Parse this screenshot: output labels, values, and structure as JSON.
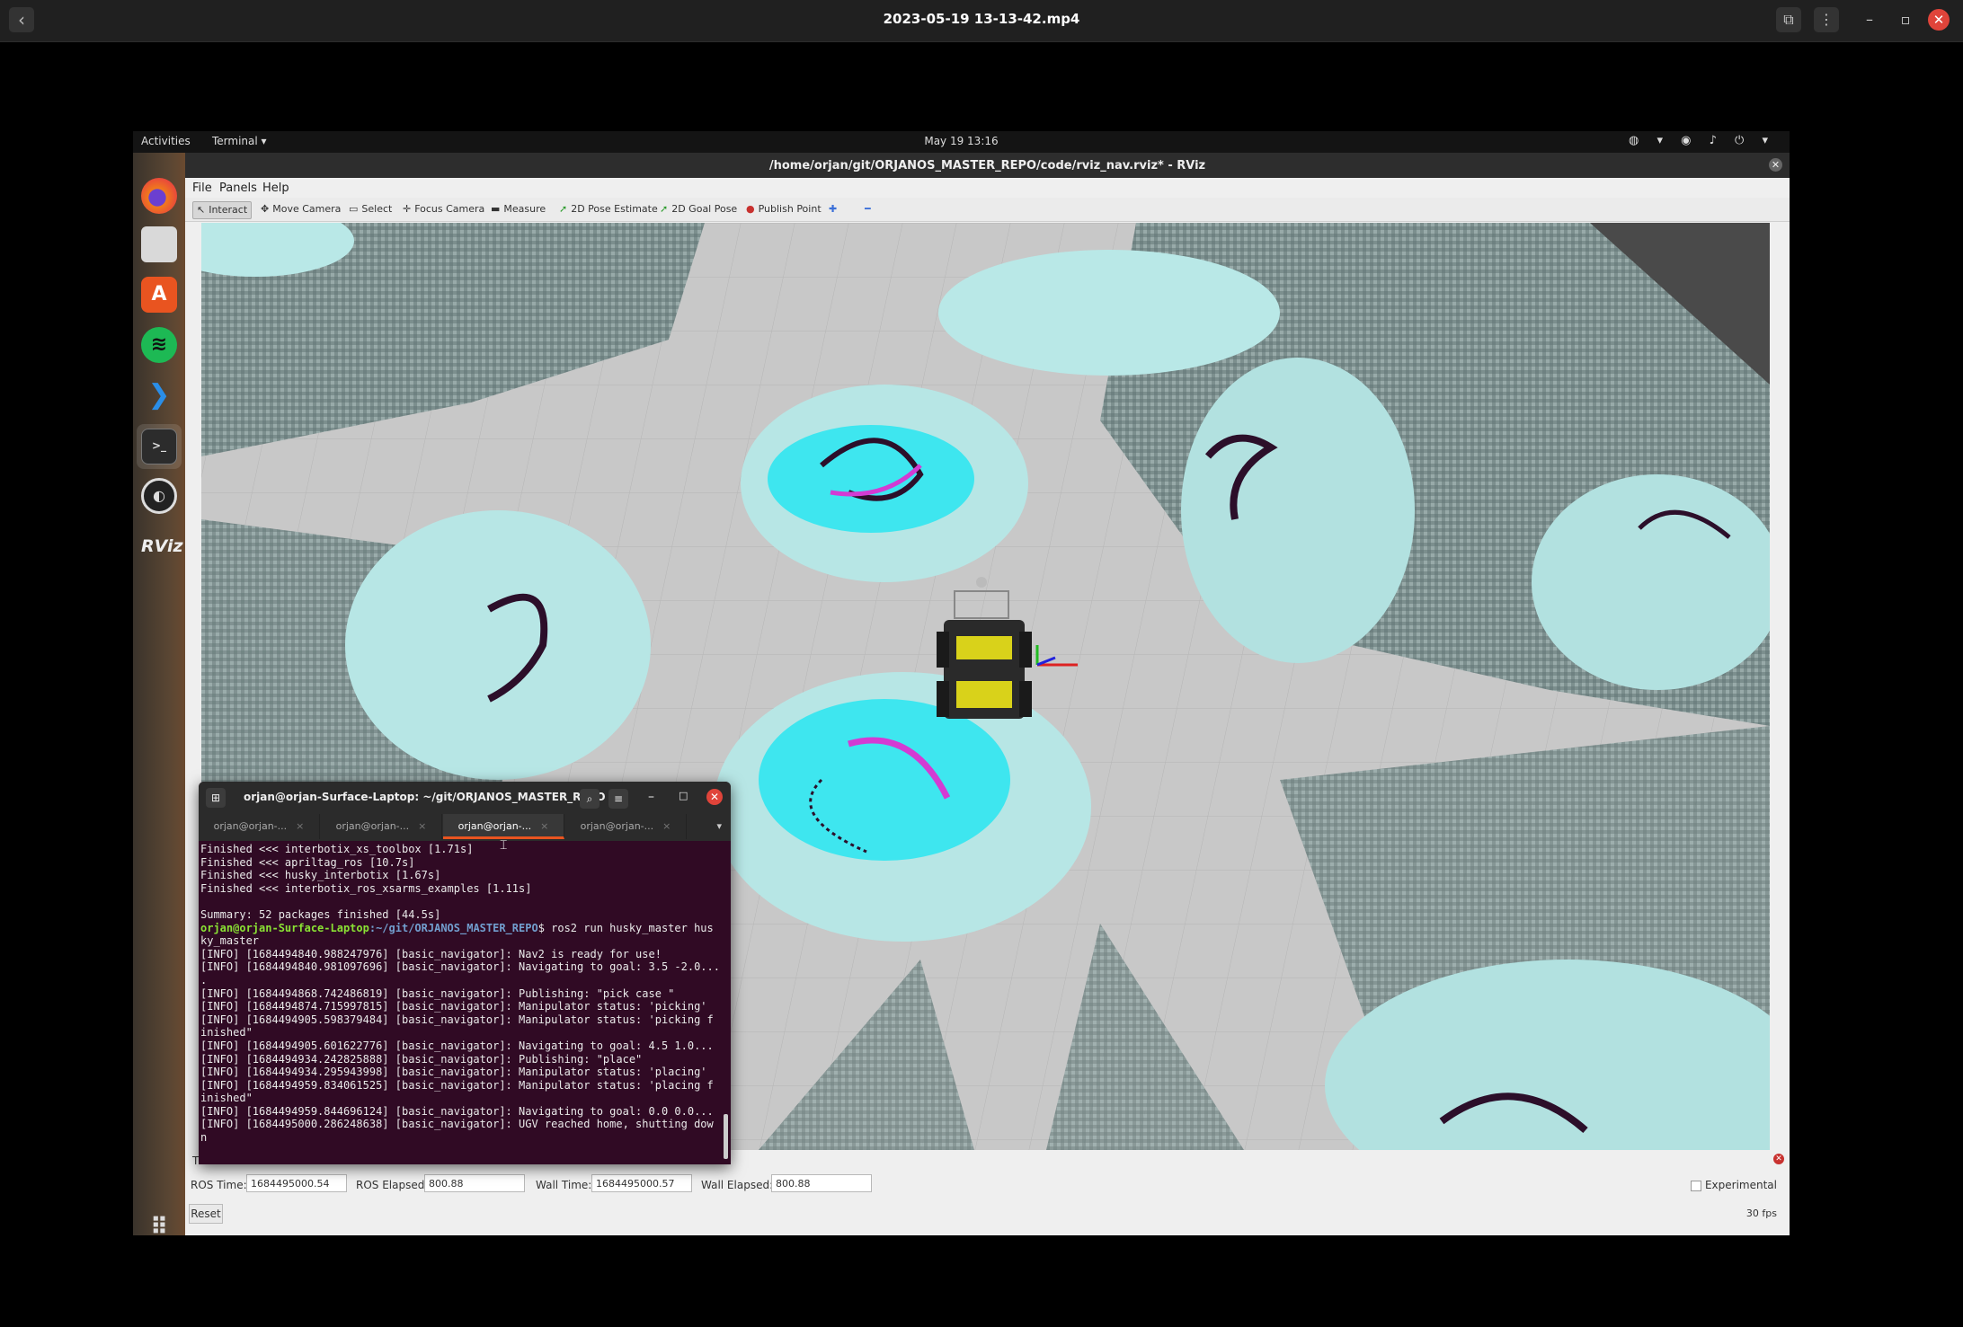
{
  "player": {
    "title": "2023-05-19 13-13-42.mp4",
    "back_icon": "‹",
    "cast_icon": "⧉",
    "menu_icon": "⋮",
    "min_icon": "–",
    "max_icon": "▫",
    "close_icon": "✕"
  },
  "topbar": {
    "activities": "Activities",
    "app_menu": "Terminal ▾",
    "clock": "May 19  13:16",
    "tray": "◍ ▾ ◉ ♪ ⏻ ▾"
  },
  "dock": {
    "firefox": "",
    "software": "A",
    "spotify": "≋",
    "vscode": "❯",
    "terminal": ">_",
    "obs": "◐",
    "rviz": "RViz",
    "apps_grid": "⠿"
  },
  "rviz": {
    "title": "/home/orjan/git/ORJANOS_MASTER_REPO/code/rviz_nav.rviz* - RViz",
    "window_buttons": "– ▫",
    "close_icon": "✕",
    "menus": [
      "File",
      "Panels",
      "Help"
    ],
    "tools": [
      {
        "icon": "↖",
        "label": "Interact"
      },
      {
        "icon": "✥",
        "label": "Move Camera"
      },
      {
        "icon": "▭",
        "label": "Select"
      },
      {
        "icon": "✛",
        "label": "Focus Camera"
      },
      {
        "icon": "▬",
        "label": "Measure"
      },
      {
        "icon": "➚",
        "label": "2D Pose Estimate"
      },
      {
        "icon": "➚",
        "label": "2D Goal Pose"
      },
      {
        "icon": "●",
        "label": "Publish Point"
      },
      {
        "icon": "✚",
        "label": ""
      },
      {
        "icon": "━",
        "label": ""
      }
    ],
    "time_panel": {
      "header": "Time",
      "ros_time_label": "ROS Time:",
      "ros_time": "1684495000.54",
      "ros_elapsed_label": "ROS Elapsed:",
      "ros_elapsed": "800.88",
      "wall_time_label": "Wall Time:",
      "wall_time": "1684495000.57",
      "wall_elapsed_label": "Wall Elapsed:",
      "wall_elapsed": "800.88",
      "experimental": "Experimental",
      "reset": "Reset",
      "fps": "30 fps"
    }
  },
  "terminal": {
    "title": "orjan@orjan-Surface-Laptop: ~/git/ORJANOS_MASTER_REPO",
    "tabs": [
      "orjan@orjan-...",
      "orjan@orjan-...",
      "orjan@orjan-...",
      "orjan@orjan-..."
    ],
    "active_tab": 2,
    "lines_before_prompt": [
      "Finished <<< interbotix_xs_toolbox [1.71s]",
      "Finished <<< apriltag_ros [10.7s]",
      "Finished <<< husky_interbotix [1.67s]",
      "Finished <<< interbotix_ros_xsarms_examples [1.11s]",
      "",
      "Summary: 52 packages finished [44.5s]"
    ],
    "prompt_user": "orjan@orjan-Surface-Laptop",
    "prompt_path": ":~/git/ORJANOS_MASTER_REPO",
    "prompt_cmd": "$ ros2 run husky_master hus",
    "lines_after_prompt": [
      "ky_master",
      "[INFO] [1684494840.988247976] [basic_navigator]: Nav2 is ready for use!",
      "[INFO] [1684494840.981097696] [basic_navigator]: Navigating to goal: 3.5 -2.0...",
      ".",
      "[INFO] [1684494868.742486819] [basic_navigator]: Publishing: \"pick case \"",
      "[INFO] [1684494874.715997815] [basic_navigator]: Manipulator status: 'picking'",
      "[INFO] [1684494905.598379484] [basic_navigator]: Manipulator status: 'picking f",
      "inished\"",
      "[INFO] [1684494905.601622776] [basic_navigator]: Navigating to goal: 4.5 1.0...",
      "[INFO] [1684494934.242825888] [basic_navigator]: Publishing: \"place\"",
      "[INFO] [1684494934.295943998] [basic_navigator]: Manipulator status: 'placing'",
      "[INFO] [1684494959.834061525] [basic_navigator]: Manipulator status: 'placing f",
      "inished\"",
      "[INFO] [1684494959.844696124] [basic_navigator]: Navigating to goal: 0.0 0.0...",
      "[INFO] [1684495000.286248638] [basic_navigator]: UGV reached home, shutting dow",
      "n"
    ]
  }
}
